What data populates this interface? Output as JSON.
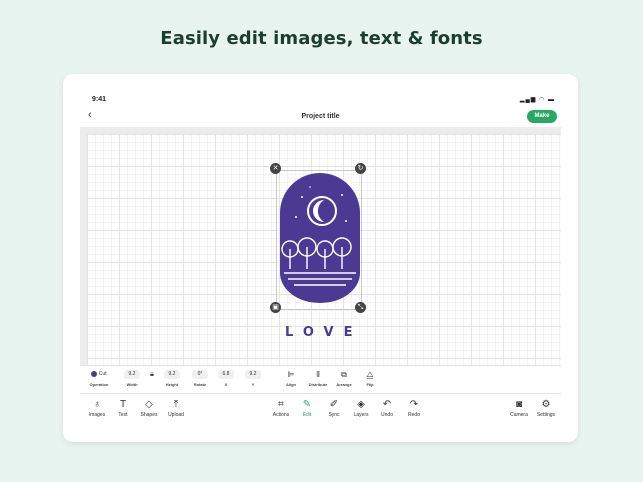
{
  "headline": "Easily edit images, text & fonts",
  "status": {
    "time": "9:41"
  },
  "nav": {
    "title": "Project title",
    "make": "Make"
  },
  "design": {
    "text": "LOVE",
    "color": "#4b3a94"
  },
  "properties": {
    "operation": {
      "value": "Cut",
      "label": "Operation"
    },
    "width": {
      "value": "9.2",
      "label": "Width"
    },
    "height": {
      "value": "9.2",
      "label": "Height"
    },
    "rotate": {
      "value": "0°",
      "label": "Rotate"
    },
    "x": {
      "value": "6.8",
      "label": "X"
    },
    "y": {
      "value": "9.2",
      "label": "Y"
    },
    "align": "Align",
    "distribute": "Distribute",
    "arrange": "Arrange",
    "flip": "Flip"
  },
  "toolbar": {
    "images": "Images",
    "text": "Text",
    "shapes": "Shapes",
    "upload": "Upload",
    "actions": "Actions",
    "edit": "Edit",
    "sync": "Sync",
    "layers": "Layers",
    "undo": "Undo",
    "redo": "Redo",
    "camera": "Camera",
    "settings": "Settings"
  },
  "colors": {
    "accent": "#2aa766",
    "design": "#4b3a94",
    "background": "#e7f4ef"
  }
}
